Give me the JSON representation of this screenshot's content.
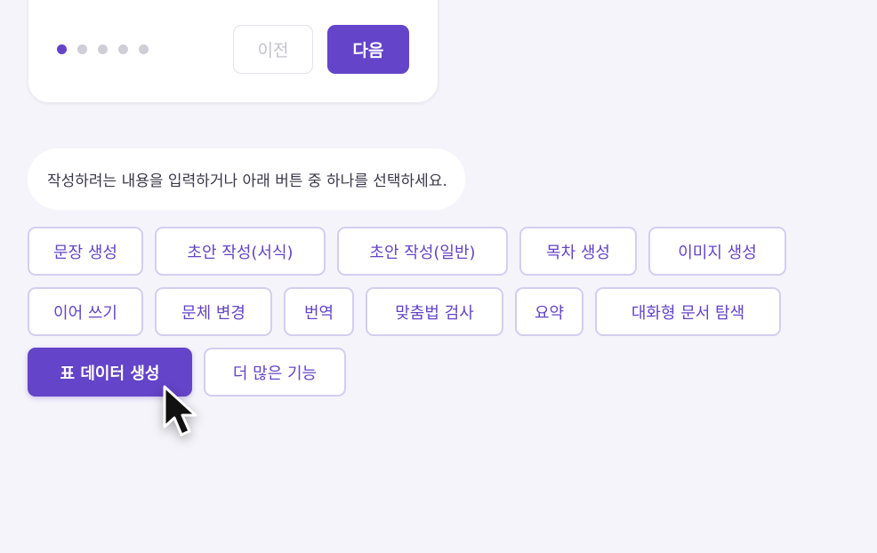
{
  "pagination": {
    "dots": [
      true,
      false,
      false,
      false,
      false
    ],
    "prev_label": "이전",
    "next_label": "다음"
  },
  "prompt": {
    "text": "작성하려는 내용을 입력하거나 아래 버튼 중 하나를 선택하세요."
  },
  "chips": [
    "문장 생성",
    "초안 작성(서식)",
    "초안 작성(일반)",
    "목차 생성",
    "이미지 생성",
    "이어 쓰기",
    "문체 변경",
    "번역",
    "맞춤법 검사",
    "요약",
    "대화형 문서 탐색",
    "표 데이터 생성",
    "더 많은 기능"
  ],
  "colors": {
    "accent": "#6444c8",
    "chip_border": "#d4cdf1",
    "background": "#f5f4fa"
  },
  "icons": {
    "cursor": "mouse-pointer-icon"
  }
}
